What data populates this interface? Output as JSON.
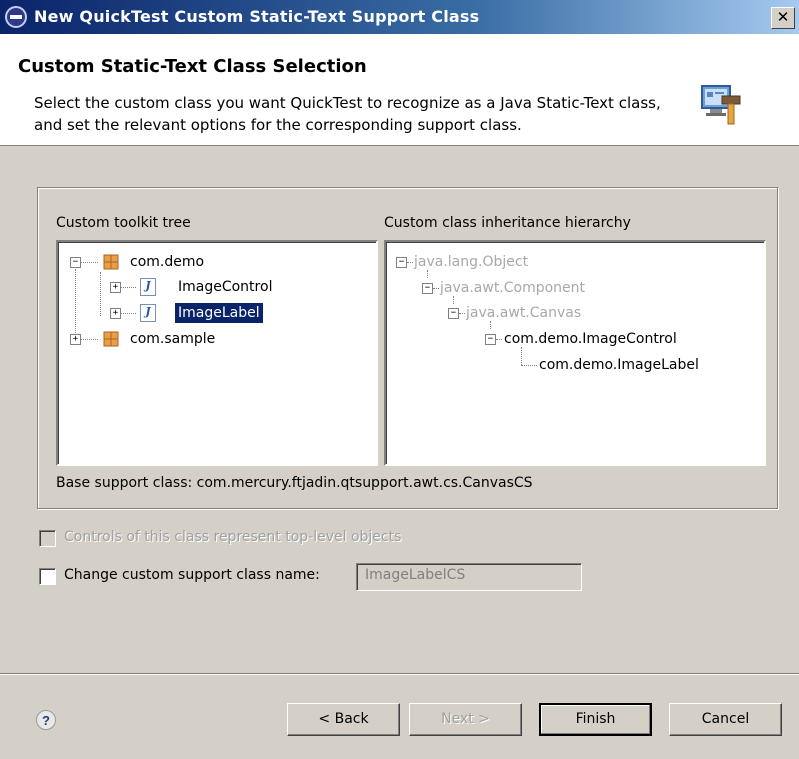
{
  "window": {
    "title": "New QuickTest Custom Static-Text Support Class",
    "close_glyph": "✕"
  },
  "header": {
    "title": "Custom Static-Text Class Selection",
    "description": "Select the custom class you want QuickTest to recognize as a Java Static-Text class, and set the relevant options for the corresponding support class."
  },
  "toolkit_tree": {
    "label": "Custom toolkit tree",
    "items": [
      {
        "label": "com.demo",
        "type": "package",
        "expanded": true
      },
      {
        "label": "ImageControl",
        "type": "class"
      },
      {
        "label": "ImageLabel",
        "type": "class",
        "selected": true
      },
      {
        "label": "com.sample",
        "type": "package",
        "expanded": false
      }
    ]
  },
  "hierarchy": {
    "label": "Custom class inheritance hierarchy",
    "items": [
      {
        "label": "java.lang.Object",
        "disabled": true
      },
      {
        "label": "java.awt.Component",
        "disabled": true
      },
      {
        "label": "java.awt.Canvas",
        "disabled": true
      },
      {
        "label": "com.demo.ImageControl",
        "disabled": false
      },
      {
        "label": "com.demo.ImageLabel",
        "disabled": false
      }
    ]
  },
  "base_support": "Base support class: com.mercury.ftjadin.qtsupport.awt.cs.CanvasCS",
  "options": {
    "top_level_label": "Controls of this class represent top-level objects",
    "top_level_checked": false,
    "top_level_enabled": false,
    "change_name_label": "Change custom support class name:",
    "change_name_checked": false,
    "class_name_value": "ImageLabelCS"
  },
  "buttons": {
    "back": "< Back",
    "next": "Next >",
    "finish": "Finish",
    "cancel": "Cancel"
  },
  "icons": {
    "help": "?",
    "expand": "+",
    "collapse": "−",
    "class_glyph": "J"
  },
  "colors": {
    "selection": "#0a246a",
    "title_bar": "#0a246a",
    "disabled_text": "#a8a8a8",
    "face": "#d4d0c8"
  }
}
